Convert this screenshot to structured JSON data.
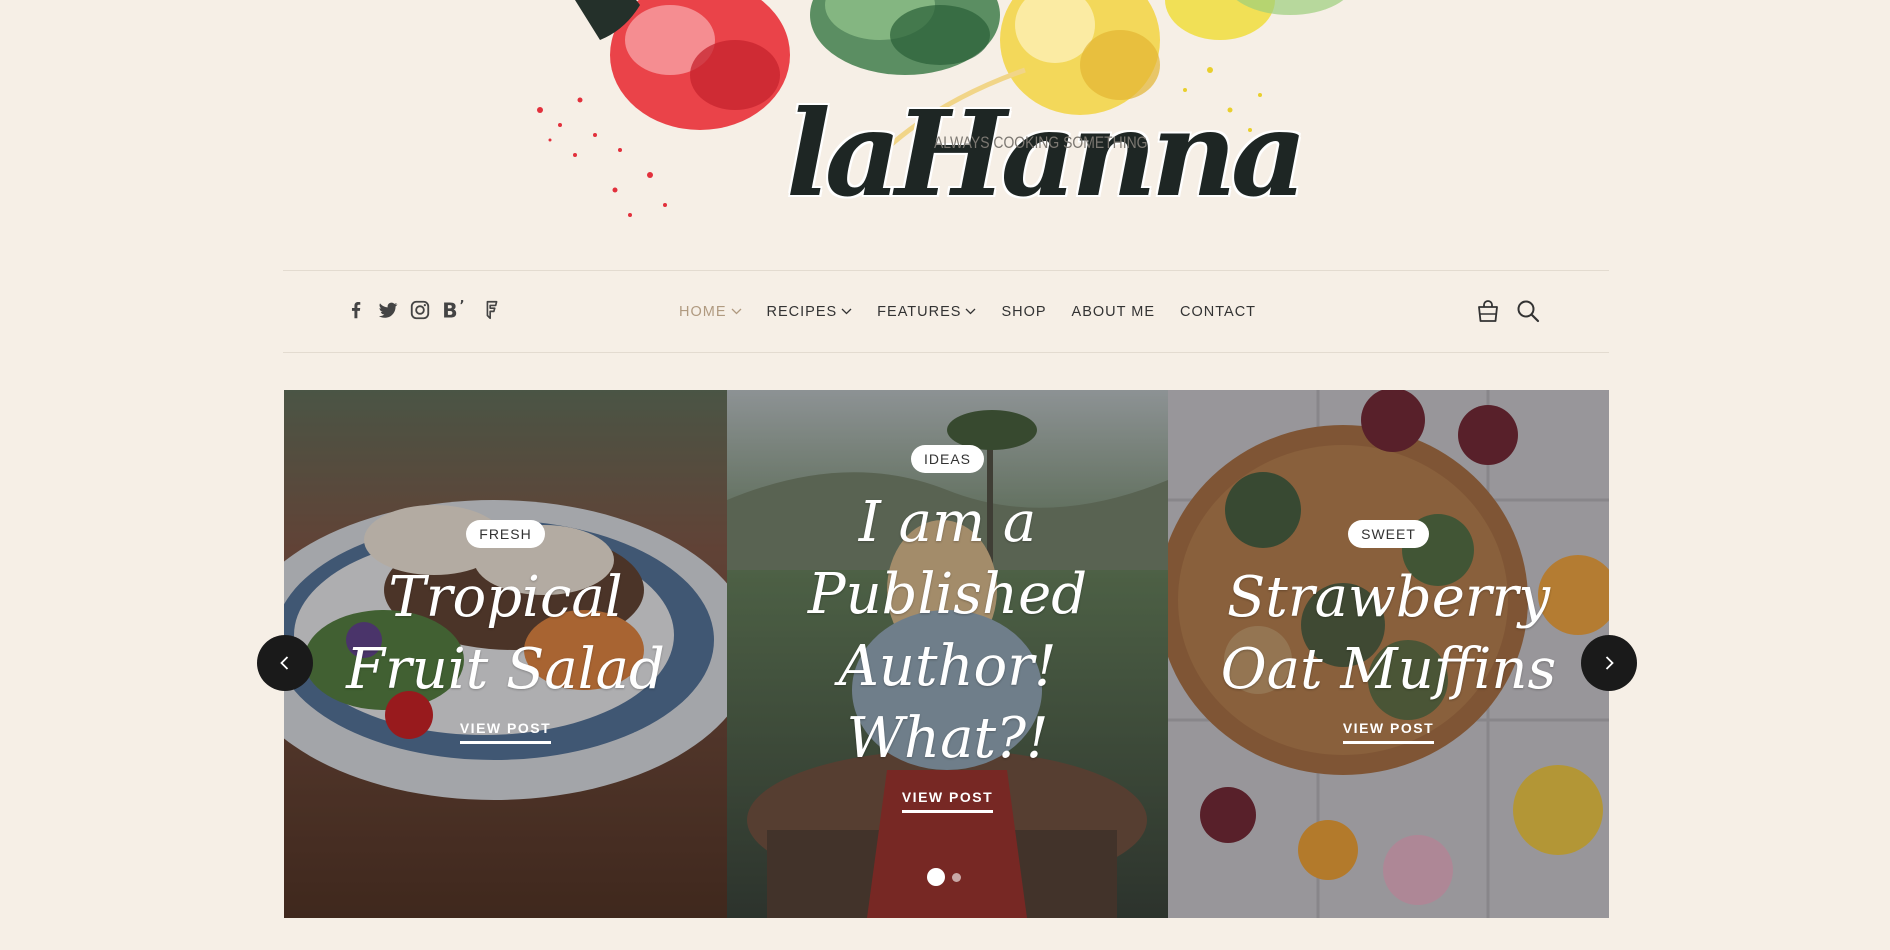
{
  "site": {
    "logo": "laHanna",
    "tagline": "ALWAYS COOKING SOMETHING"
  },
  "social": [
    "facebook-icon",
    "twitter-icon",
    "instagram-icon",
    "bloglovin-icon",
    "foursquare-icon"
  ],
  "menu": {
    "items": [
      {
        "label": "HOME",
        "dropdown": true,
        "active": true
      },
      {
        "label": "RECIPES",
        "dropdown": true
      },
      {
        "label": "FEATURES",
        "dropdown": true
      },
      {
        "label": "SHOP",
        "dropdown": false
      },
      {
        "label": "ABOUT ME",
        "dropdown": false
      },
      {
        "label": "CONTACT",
        "dropdown": false
      }
    ]
  },
  "tools": [
    "shopping-bag-icon",
    "search-icon"
  ],
  "slider": {
    "slides": [
      {
        "badge": "FRESH",
        "title_line1": "Tropical",
        "title_line2": "Fruit Salad",
        "cta": "VIEW POST"
      },
      {
        "badge": "IDEAS",
        "title_line1": "I am a",
        "title_line2": "Published",
        "title_line3": "Author!",
        "title_line4": "What?!",
        "cta": "VIEW POST"
      },
      {
        "badge": "SWEET",
        "title_line1": "Strawberry",
        "title_line2": "Oat Muffins",
        "cta": "VIEW POST"
      }
    ],
    "current_page": 1,
    "page_count": 2
  },
  "colors": {
    "background": "#f6efe6",
    "active_menu": "#b09a80",
    "text": "#333333"
  }
}
